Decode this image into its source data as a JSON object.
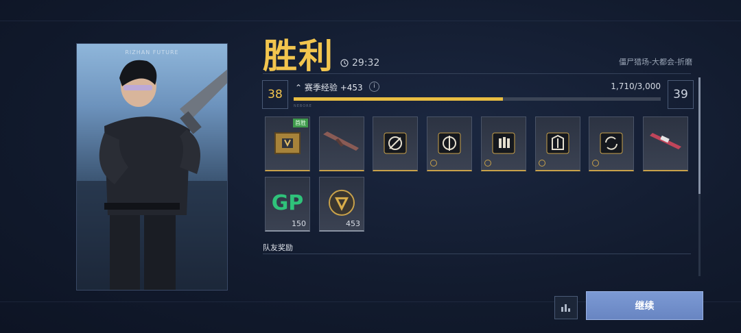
{
  "portrait": {
    "brand_text": "RIZHAN FUTURE"
  },
  "result": {
    "title": "胜利",
    "time": "29:32",
    "mode": "僵尸猎场-大都会-折磨"
  },
  "progress": {
    "current_level": "38",
    "next_level": "39",
    "xp_label": "赛季经验 +453",
    "info": "i",
    "xp_text": "1,710/3,000",
    "xp_fraction": 0.57,
    "tag": "NEBORE"
  },
  "rewards": [
    {
      "name": "supply-crate",
      "badge": "首胜",
      "rarity": "gold"
    },
    {
      "name": "weapon-skin-rifle",
      "rarity": "gold"
    },
    {
      "name": "blueprint-emblem-1",
      "rarity": "gold"
    },
    {
      "name": "blueprint-emblem-2",
      "rarity": "gold"
    },
    {
      "name": "blueprint-emblem-3",
      "rarity": "gold"
    },
    {
      "name": "blueprint-emblem-4",
      "rarity": "gold"
    },
    {
      "name": "blueprint-emblem-5",
      "rarity": "gold"
    },
    {
      "name": "weapon-skin-sniper",
      "rarity": "gold"
    },
    {
      "name": "gp-currency",
      "label": "GP",
      "qty": "150",
      "rarity": "grey"
    },
    {
      "name": "season-coin",
      "qty": "453",
      "rarity": "grey"
    }
  ],
  "team_rewards_label": "队友奖励",
  "continue_label": "继续",
  "colors": {
    "accent": "#f2c54e",
    "button": "#6f8cc8",
    "gp_green": "#2fc27a"
  }
}
